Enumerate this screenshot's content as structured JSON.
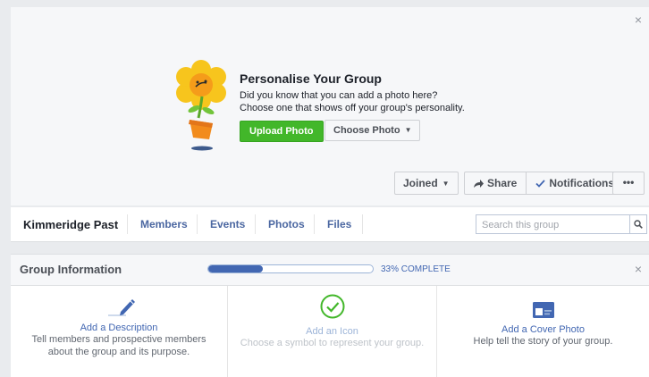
{
  "cover": {
    "promo_title": "Personalise Your Group",
    "promo_line1": "Did you know that you can add a photo here?",
    "promo_line2": "Choose one that shows off your group's personality.",
    "upload_label": "Upload Photo",
    "choose_label": "Choose Photo",
    "close_label": "×",
    "illustration": "flower-pot-icon"
  },
  "actions": {
    "joined_label": "Joined",
    "share_label": "Share",
    "notifications_label": "Notifications",
    "more_label": "•••"
  },
  "group_nav": {
    "group_name": "Kimmeridge Past",
    "items": [
      "Members",
      "Events",
      "Photos",
      "Files"
    ],
    "search_placeholder": "Search this group"
  },
  "group_info": {
    "title": "Group Information",
    "progress_fraction": 0.33,
    "progress_text": "33% COMPLETE",
    "close_label": "×",
    "cards": [
      {
        "icon": "pencil-icon",
        "link": "Add a Description",
        "desc_line1": "Tell members and prospective members",
        "desc_line2": "about the group and its purpose."
      },
      {
        "icon": "check-circle-icon",
        "link": "Add an Icon",
        "desc_line1": "Choose a symbol to represent your group.",
        "desc_line2": ""
      },
      {
        "icon": "cover-photo-icon",
        "link": "Add a Cover Photo",
        "desc_line1": "Help tell the story of your group.",
        "desc_line2": ""
      }
    ]
  },
  "colors": {
    "upload_green": "#42b72a",
    "link_blue": "#4267b2",
    "nav_blue": "#4b67a1",
    "icon_green": "#42b72a",
    "icon_blue": "#4267b2"
  }
}
